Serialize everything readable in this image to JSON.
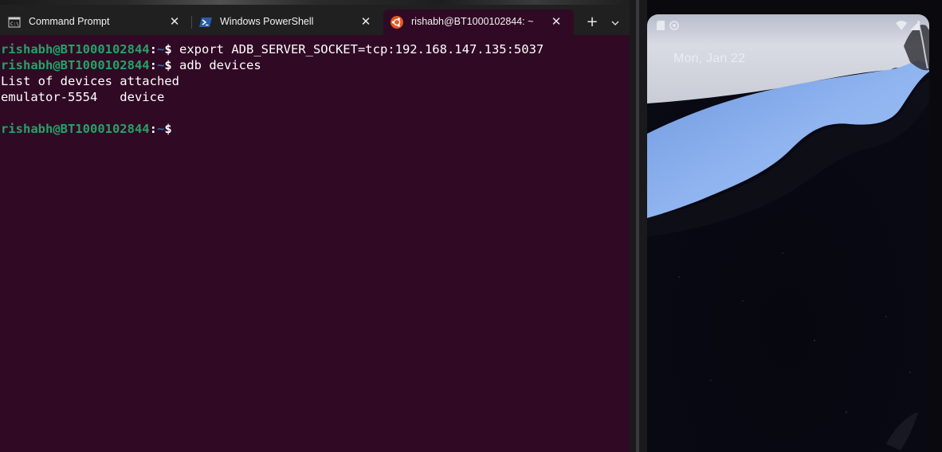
{
  "tabs": [
    {
      "label": "Command Prompt",
      "icon": "cmd-icon"
    },
    {
      "label": "Windows PowerShell",
      "icon": "powershell-icon"
    },
    {
      "label": "rishabh@BT1000102844: ~",
      "icon": "ubuntu-icon",
      "active": true
    }
  ],
  "tab_bar": {
    "close_glyph": "✕",
    "new_tab_glyph": "+",
    "dropdown_glyph": "⌄"
  },
  "terminal": {
    "prompt_user": "rishabh@BT1000102844",
    "prompt_sep": ":",
    "prompt_path": "~",
    "prompt_symbol": "$",
    "cmd1": " export ADB_SERVER_SOCKET=tcp:192.168.147.135:5037",
    "cmd2": " adb devices",
    "out1": "List of devices attached",
    "out2": "emulator-5554   device"
  },
  "emulator": {
    "date": "Mon, Jan 22",
    "status_left_icons": [
      "sd-card-icon",
      "circle-status-icon"
    ],
    "status_right_icons": [
      "wifi-icon",
      "cellular-signal-icon"
    ]
  },
  "colors": {
    "terminal_bg": "#300a24",
    "prompt_user": "#26a269",
    "prompt_path": "#3465a4",
    "tabbar_bg": "#202020",
    "wallpaper_blue": "#8fb4ef"
  }
}
